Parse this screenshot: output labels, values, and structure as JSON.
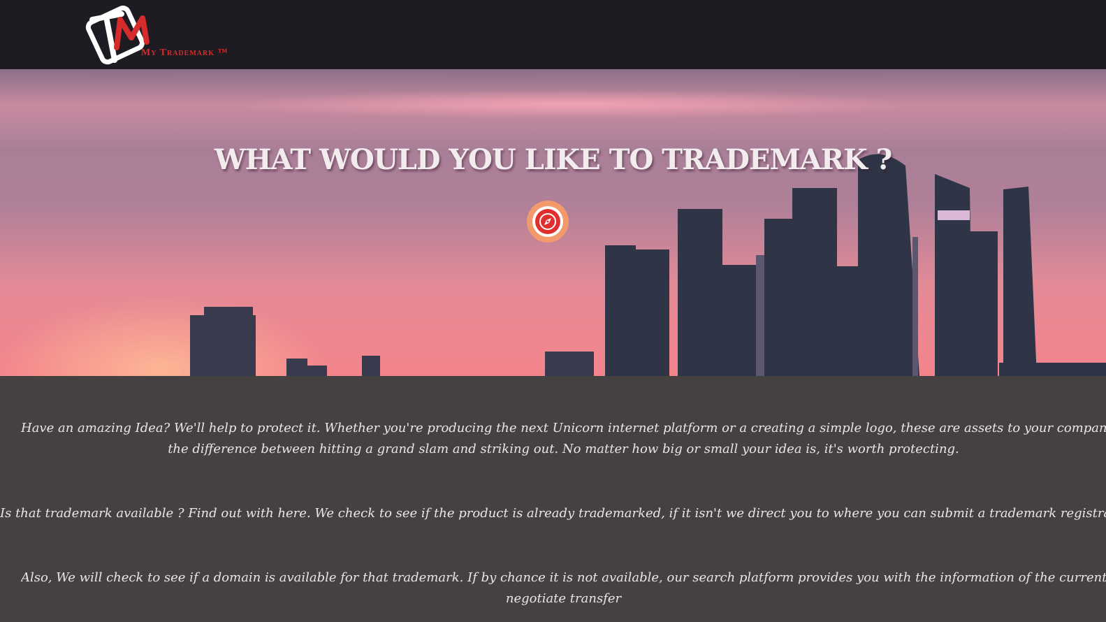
{
  "brand": {
    "logo_text": "My Trademark ™",
    "logo_icon": "tm-logo-icon"
  },
  "hero": {
    "title": "WHAT WOULD YOU LIKE TO TRADEMARK ?",
    "explore_icon": "compass-icon"
  },
  "content": {
    "paragraph1_line1": "Have an amazing Idea? We'll help to protect it. Whether you're producing the next Unicorn internet platform or a creating a simple logo, these are assets to your company and they can me",
    "paragraph1_line2": "the difference between hitting a grand slam and striking out. No matter how big or small your idea is, it's worth protecting.",
    "paragraph2": "Is that trademark available ? Find out with here. We check to see if the product is already trademarked, if it isn't we direct you to where you can submit a trademark registration.",
    "paragraph3_line1": "Also, We will check to see if a domain is available for that trademark. If by chance it is not available, our search platform provides you with the information of the current owner i f you wish",
    "paragraph3_line2": "negotiate transfer"
  },
  "colors": {
    "topbar": "#1e1c22",
    "brand_red": "#d62b2b",
    "content_bg": "#454141",
    "button_outer": "#f39a6c"
  }
}
